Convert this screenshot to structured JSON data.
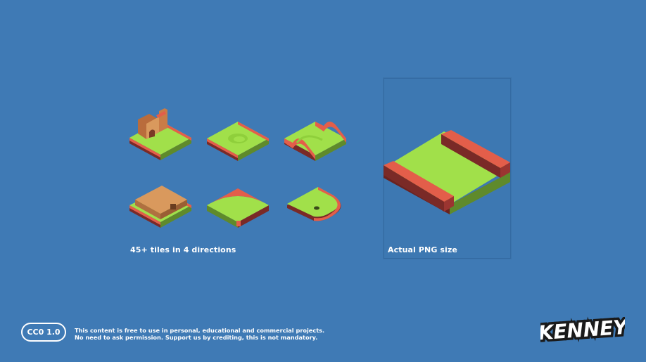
{
  "captions": {
    "tiles": "45+ tiles in 4 directions",
    "preview": "Actual PNG size"
  },
  "license": {
    "badge": "CC0 1.0",
    "line1": "This content is free to use in personal, educational and commercial projects.",
    "line2": "No need to ask permission. Support us by crediting, this is not mandatory."
  },
  "brand": {
    "logo": "KENNEY"
  },
  "colors": {
    "background": "#3f7ab5",
    "grass": "#a1e04a",
    "wall": "#e35e4a",
    "wall_dark": "#7a2a27",
    "wood": "#d9995d"
  }
}
